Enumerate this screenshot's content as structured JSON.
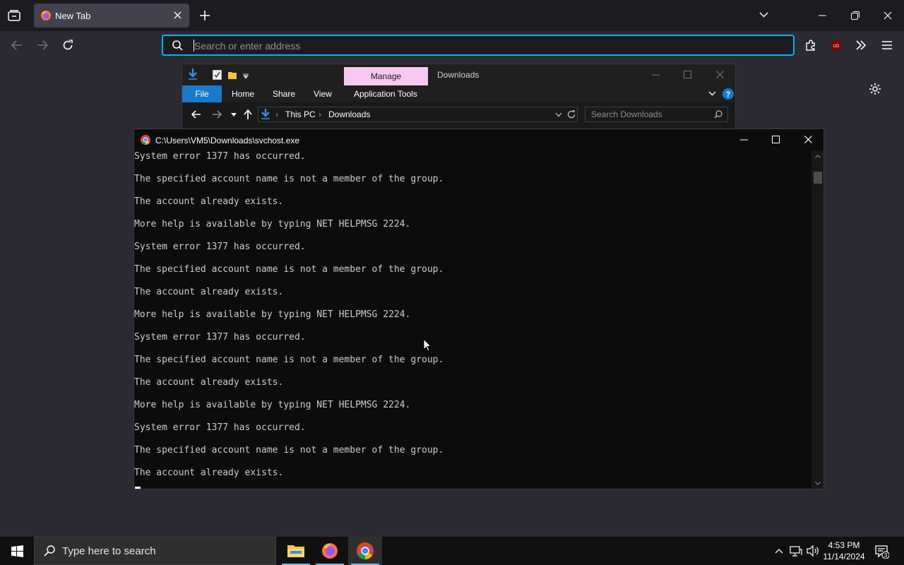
{
  "browser": {
    "tab_title": "New Tab",
    "url_placeholder": "Search or enter address",
    "ublock_badge": "UD"
  },
  "explorer": {
    "manage_label": "Manage",
    "window_title": "Downloads",
    "ribbon_tabs": [
      "File",
      "Home",
      "Share",
      "View",
      "Application Tools"
    ],
    "breadcrumb": [
      "This PC",
      "Downloads"
    ],
    "search_placeholder": "Search Downloads"
  },
  "console": {
    "title": "C:\\Users\\VM5\\Downloads\\svchost.exe",
    "lines": [
      "System error 1377 has occurred.",
      "The specified account name is not a member of the group.",
      "The account already exists.",
      "More help is available by typing NET HELPMSG 2224.",
      "System error 1377 has occurred.",
      "The specified account name is not a member of the group.",
      "The account already exists.",
      "More help is available by typing NET HELPMSG 2224.",
      "System error 1377 has occurred.",
      "The specified account name is not a member of the group.",
      "The account already exists.",
      "More help is available by typing NET HELPMSG 2224.",
      "System error 1377 has occurred.",
      "The specified account name is not a member of the group.",
      "The account already exists."
    ]
  },
  "taskbar": {
    "search_placeholder": "Type here to search",
    "time": "4:53 PM",
    "date": "11/14/2024",
    "notification_count": "3"
  },
  "colors": {
    "accent_focus": "#00b3f4",
    "manage_tab": "#f7c8f1",
    "file_tab": "#1979ca",
    "taskbar_indicator": "#76b9ed"
  }
}
